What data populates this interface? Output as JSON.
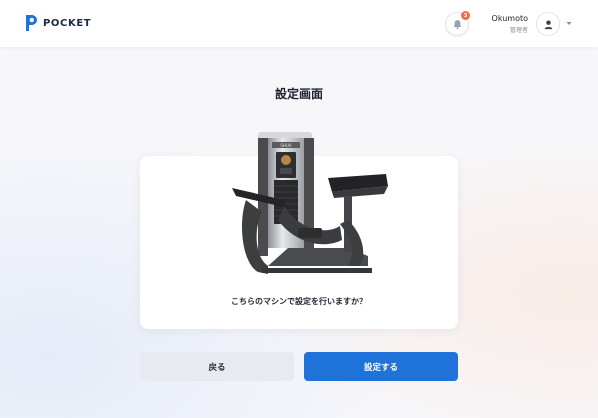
{
  "header": {
    "logo_text": "POCKET",
    "notification_count": "3",
    "user_name": "Okumoto",
    "user_role": "管理者"
  },
  "main": {
    "title": "設定画面",
    "machine_brand": "SHUA",
    "question": "こちらのマシンで設定を行いますか？",
    "back_label": "戻る",
    "confirm_label": "設定する"
  },
  "colors": {
    "primary": "#1f72d8",
    "badge": "#f2684b",
    "logo": "#1f72d8"
  },
  "icons": [
    "pocket-logo-icon",
    "bell-icon",
    "user-icon",
    "chevron-down-icon"
  ]
}
